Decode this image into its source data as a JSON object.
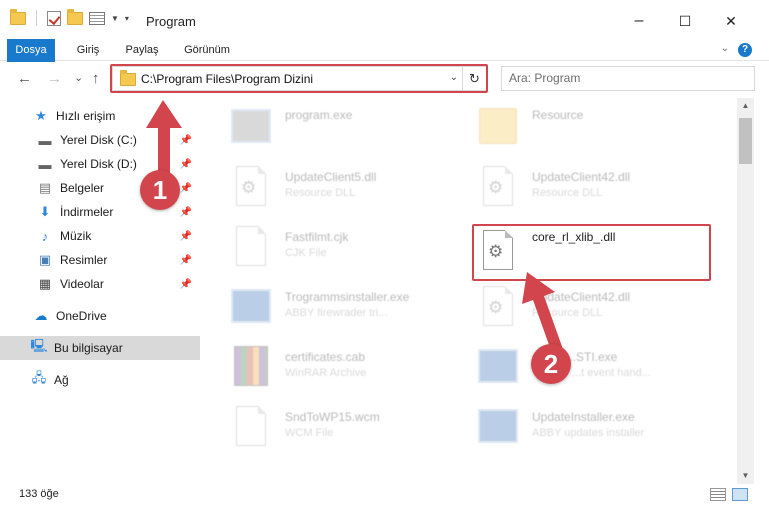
{
  "window": {
    "title": "Program",
    "minimize": "–",
    "maximize": "☐",
    "close": "✕"
  },
  "ribbon": {
    "tabs": [
      "Dosya",
      "Giriş",
      "Paylaş",
      "Görünüm"
    ],
    "help": "?"
  },
  "nav": {
    "back": "←",
    "forward": "→",
    "recent": "⌄",
    "up": "↑",
    "address": "C:\\Program Files\\Program Dizini",
    "search_placeholder": "Ara: Program"
  },
  "sidebar": {
    "quick_access": "Hızlı erişim",
    "items": [
      {
        "label": "Yerel Disk (C:)",
        "icon": "drive-icon"
      },
      {
        "label": "Yerel Disk (D:)",
        "icon": "drive-icon"
      },
      {
        "label": "Belgeler",
        "icon": "documents-icon"
      },
      {
        "label": "İndirmeler",
        "icon": "download-icon"
      },
      {
        "label": "Müzik",
        "icon": "music-icon"
      },
      {
        "label": "Resimler",
        "icon": "pictures-icon"
      },
      {
        "label": "Videolar",
        "icon": "videos-icon"
      }
    ],
    "onedrive": "OneDrive",
    "this_pc": "Bu bilgisayar",
    "network": "Ağ"
  },
  "files": {
    "left": [
      {
        "name": "program.exe",
        "type": "",
        "icon": "exe-icon"
      },
      {
        "name": "UpdateClient5.dll",
        "type": "Resource DLL",
        "icon": "dll-icon"
      },
      {
        "name": "Fastfilmt.cjk",
        "type": "CJK File",
        "icon": "file-icon"
      },
      {
        "name": "Trogrammsinstaller.exe",
        "type": "ABBY firewrader tri...",
        "icon": "installer-icon"
      },
      {
        "name": "certificates.cab",
        "type": "WinRAR Archive",
        "icon": "archive-icon"
      },
      {
        "name": "SndToWP15.wcm",
        "type": "WCM File",
        "icon": "file-icon"
      }
    ],
    "right": [
      {
        "name": "Resource",
        "type": "",
        "icon": "folder-icon"
      },
      {
        "name": "UpdateClient42.dll",
        "type": "Resource DLL",
        "icon": "dll-icon"
      },
      {
        "name": "core_rl_xlib_.dll",
        "type": "",
        "icon": "dll-icon"
      },
      {
        "name": "UpdateClient42.dll",
        "type": "Resource DLL",
        "icon": "dll-icon"
      },
      {
        "name": "...STI.exe",
        "type": "...t event hand...",
        "icon": "installer-icon"
      },
      {
        "name": "UpdateInstaller.exe",
        "type": "ABBY updates installer",
        "icon": "installer-icon"
      }
    ]
  },
  "status": {
    "count": "133 öğe"
  },
  "callouts": {
    "one": "1",
    "two": "2"
  }
}
